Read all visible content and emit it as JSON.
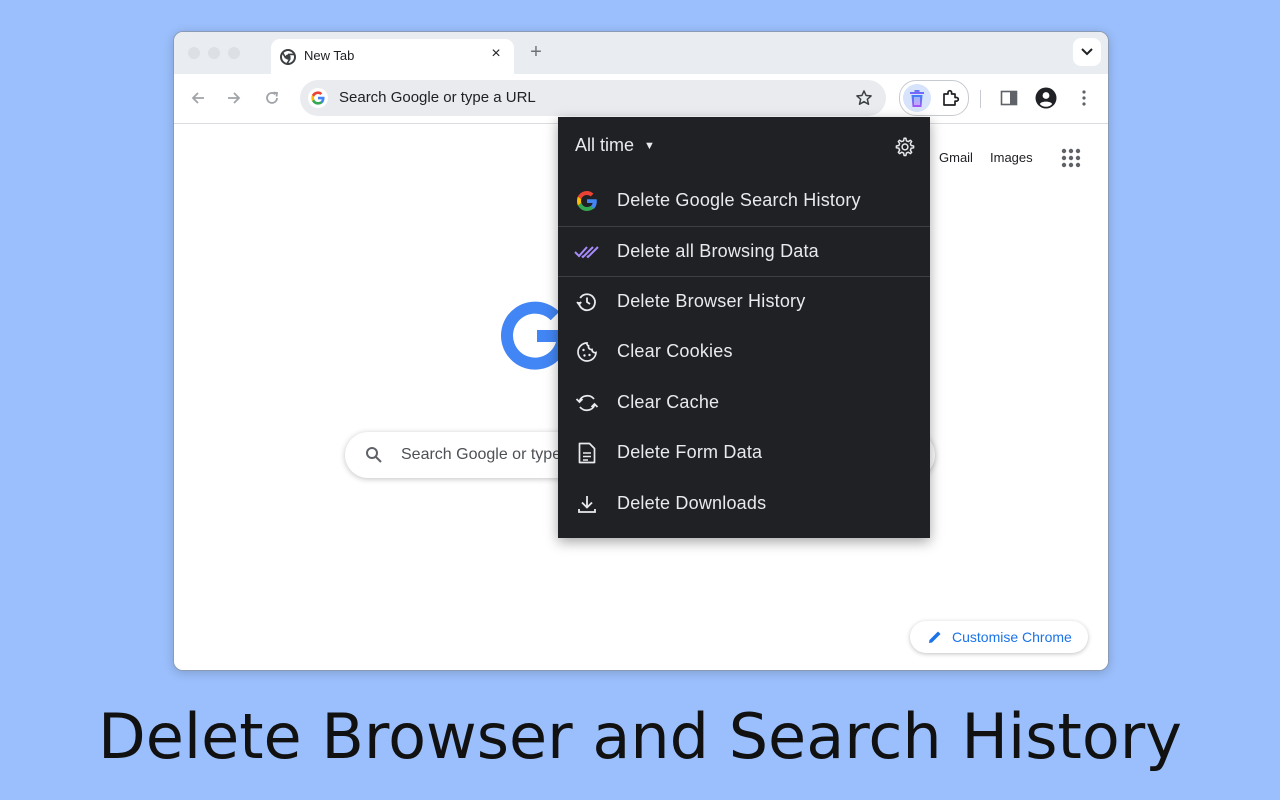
{
  "browser": {
    "tab": {
      "title": "New Tab",
      "close_label": "×"
    },
    "new_tab_label": "+",
    "omnibox": {
      "text": "Search Google or type a URL"
    }
  },
  "page": {
    "links": {
      "gmail": "Gmail",
      "images": "Images"
    },
    "search_placeholder": "Search Google or type",
    "customise_label": "Customise Chrome"
  },
  "popup": {
    "range": "All time",
    "items": [
      {
        "label": "Delete Google Search History",
        "icon": "google-g-icon"
      },
      {
        "label": "Delete all Browsing Data",
        "icon": "double-check-icon"
      },
      {
        "label": "Delete Browser History",
        "icon": "history-icon"
      },
      {
        "label": "Clear Cookies",
        "icon": "cookie-icon"
      },
      {
        "label": "Clear Cache",
        "icon": "refresh-icon"
      },
      {
        "label": "Delete Form Data",
        "icon": "document-icon"
      },
      {
        "label": "Delete Downloads",
        "icon": "download-icon"
      }
    ]
  },
  "caption": "Delete Browser and Search History",
  "colors": {
    "background": "#9bbffc",
    "popup_bg": "#202124",
    "accent_blue": "#1a73e8",
    "check_purple": "#a78bfa"
  }
}
